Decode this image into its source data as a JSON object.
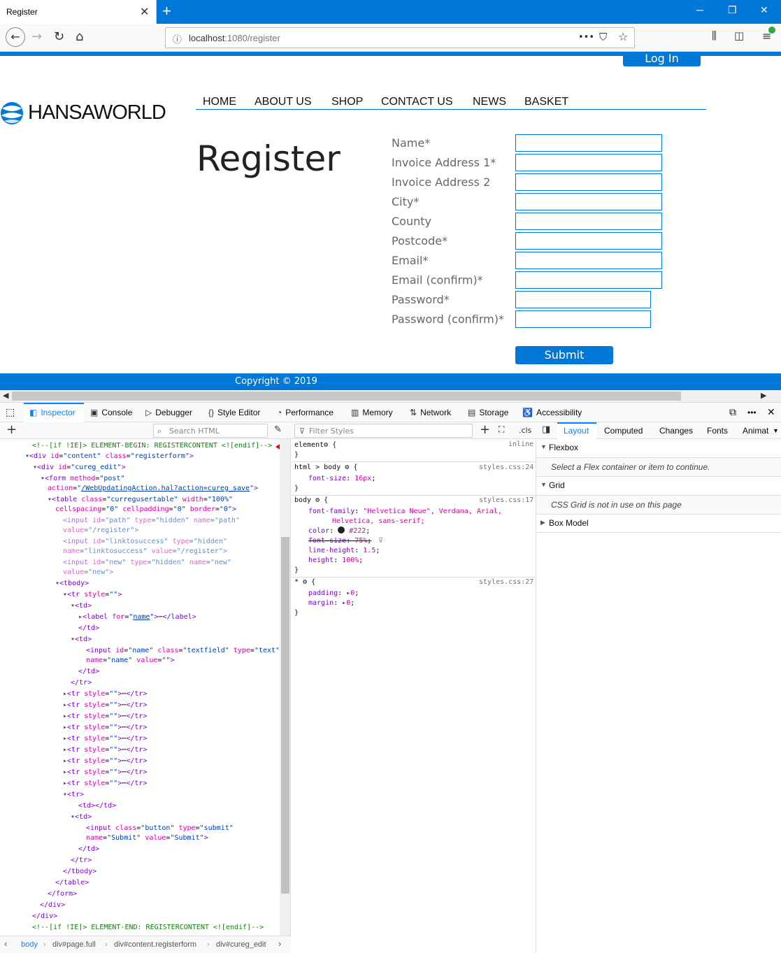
{
  "browser": {
    "tab_title": "Register",
    "url_host": "localhost",
    "url_rest": ":1080/register",
    "page_actions": "•••"
  },
  "page": {
    "login_label": "Log In",
    "logo_text": "HANSAWORLD",
    "nav": [
      "HOME",
      "ABOUT US",
      "SHOP",
      "CONTACT US",
      "NEWS",
      "BASKET"
    ],
    "title": "Register",
    "fields": [
      {
        "label": "Name",
        "req": "*"
      },
      {
        "label": "Invoice Address 1",
        "req": "*"
      },
      {
        "label": "Invoice Address 2",
        "req": ""
      },
      {
        "label": "City",
        "req": "*"
      },
      {
        "label": "County",
        "req": ""
      },
      {
        "label": "Postcode",
        "req": "*"
      },
      {
        "label": "Email",
        "req": "*"
      },
      {
        "label": "Email (confirm)",
        "req": "*"
      },
      {
        "label": "Password",
        "req": "*"
      },
      {
        "label": "Password (confirm)",
        "req": "*"
      }
    ],
    "submit_label": "Submit",
    "copyright": "Copyright © 2019"
  },
  "devtools": {
    "tabs": [
      "Inspector",
      "Console",
      "Debugger",
      "Style Editor",
      "Performance",
      "Memory",
      "Network",
      "Storage",
      "Accessibility"
    ],
    "search_html_placeholder": "Search HTML",
    "filter_styles_placeholder": "Filter Styles",
    "cls_label": ".cls",
    "right_tabs": [
      "Layout",
      "Computed",
      "Changes",
      "Fonts",
      "Animat"
    ],
    "flexbox_title": "Flexbox",
    "flexbox_msg": "Select a Flex container or item to continue.",
    "grid_title": "Grid",
    "grid_msg": "CSS Grid is not in use on this page",
    "boxmodel_title": "Box Model",
    "breadcrumbs": [
      "body",
      "div#page.full",
      "div#content.registerform",
      "div#cureg_edit"
    ],
    "rules": {
      "element_sel": "element",
      "element_open": " {",
      "inline": "inline",
      "close": "}",
      "html_body_sel": "html > body",
      "html_body_src": "styles.css:24",
      "font_size_prop": "font-size",
      "font_size_val": "16px",
      "body_sel": "body",
      "body_src": "styles.css:17",
      "font_family_prop": "font-family",
      "font_family_val1": "\"Helvetica Neue\", Verdana, Arial,",
      "font_family_val2": "Helvetica, sans-serif;",
      "color_prop": "color",
      "color_val": "#222",
      "font_size2_prop": "font-size",
      "font_size2_val": "75%",
      "line_height_prop": "line-height",
      "line_height_val": "1.5",
      "height_prop": "height",
      "height_val": "100%",
      "star_sel": "*",
      "star_src": "styles.css:27",
      "padding_prop": "padding",
      "padding_val": "0",
      "margin_prop": "margin",
      "margin_val": "0"
    }
  }
}
